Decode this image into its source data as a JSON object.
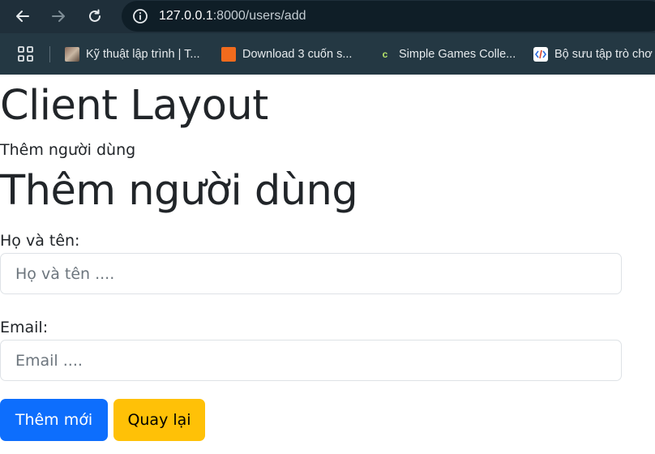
{
  "browser": {
    "url_host": "127.0.0.1",
    "url_rest": ":8000/users/add",
    "bookmarks": [
      {
        "label": "Kỹ thuật lập trình | T..."
      },
      {
        "label": "Download 3 cuốn s..."
      },
      {
        "label": "Simple Games Colle..."
      },
      {
        "label": "Bộ sưu tập trò chơ"
      }
    ]
  },
  "page": {
    "layout_title": "Client Layout",
    "breadcrumb": "Thêm người dùng",
    "heading": "Thêm người dùng",
    "form": {
      "fullname_label": "Họ và tên:",
      "fullname_placeholder": "Họ và tên ....",
      "email_label": "Email:",
      "email_placeholder": "Email ....",
      "submit_label": "Thêm mới",
      "back_label": "Quay lại"
    }
  },
  "colors": {
    "primary": "#0d6efd",
    "warning": "#ffc107",
    "chrome_bg": "#1f2f3a"
  }
}
